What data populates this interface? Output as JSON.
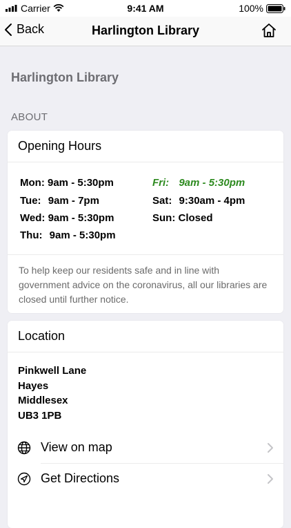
{
  "status": {
    "carrier": "Carrier",
    "time": "9:41 AM",
    "battery": "100%"
  },
  "nav": {
    "back": "Back",
    "title": "Harlington Library",
    "home_icon": "home-icon"
  },
  "page_heading": "Harlington Library",
  "section_label": "ABOUT",
  "opening_hours": {
    "title": "Opening Hours",
    "left": [
      {
        "day": "Mon:",
        "hours": "9am - 5:30pm"
      },
      {
        "day": "Tue:",
        "hours": "9am - 7pm"
      },
      {
        "day": "Wed:",
        "hours": "9am - 5:30pm"
      },
      {
        "day": "Thu:",
        "hours": "9am - 5:30pm"
      }
    ],
    "right": [
      {
        "day": "Fri:",
        "hours": "9am - 5:30pm",
        "today": true
      },
      {
        "day": "Sat:",
        "hours": "9:30am - 4pm"
      },
      {
        "day": "Sun:",
        "hours": "Closed"
      }
    ],
    "notice": "To help keep our residents safe and in line with government advice on the coronavirus, all our libraries are closed until further notice.",
    "today_color": "#2d8a1f"
  },
  "location": {
    "title": "Location",
    "address": [
      "Pinkwell Lane",
      "Hayes",
      "Middlesex",
      "UB3 1PB"
    ],
    "actions": [
      {
        "label": "View on map",
        "icon": "globe-icon"
      },
      {
        "label": "Get Directions",
        "icon": "navigation-arrow-icon"
      }
    ]
  }
}
